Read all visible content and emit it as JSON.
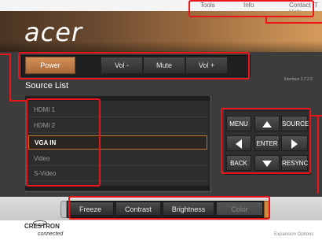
{
  "top_links": {
    "tools": "Tools",
    "info": "Info",
    "help": "Contact IT Help"
  },
  "brand": {
    "logo": "acer"
  },
  "controls": {
    "power": "Power",
    "vol_down": "Vol -",
    "mute": "Mute",
    "vol_up": "Vol +"
  },
  "version": "Interface 2.7.2.5",
  "source": {
    "title": "Source List",
    "items": [
      "HDMI 1",
      "HDMI 2",
      "VGA IN",
      "Video",
      "S-Video"
    ],
    "selected": "VGA IN"
  },
  "nav": {
    "menu": "MENU",
    "source": "SOURCE",
    "enter": "ENTER",
    "back": "BACK",
    "resync": "RESYNC"
  },
  "bottom": {
    "freeze": "Freeze",
    "contrast": "Contrast",
    "brightness": "Brightness",
    "color": "Color"
  },
  "footer": {
    "crestron": "CRESTRON",
    "connected": "connected",
    "expansion": "Expansion Options"
  },
  "colors": {
    "accent": "#c07a3e",
    "annotation": "#e8161b",
    "panel": "#3c3c3c"
  }
}
